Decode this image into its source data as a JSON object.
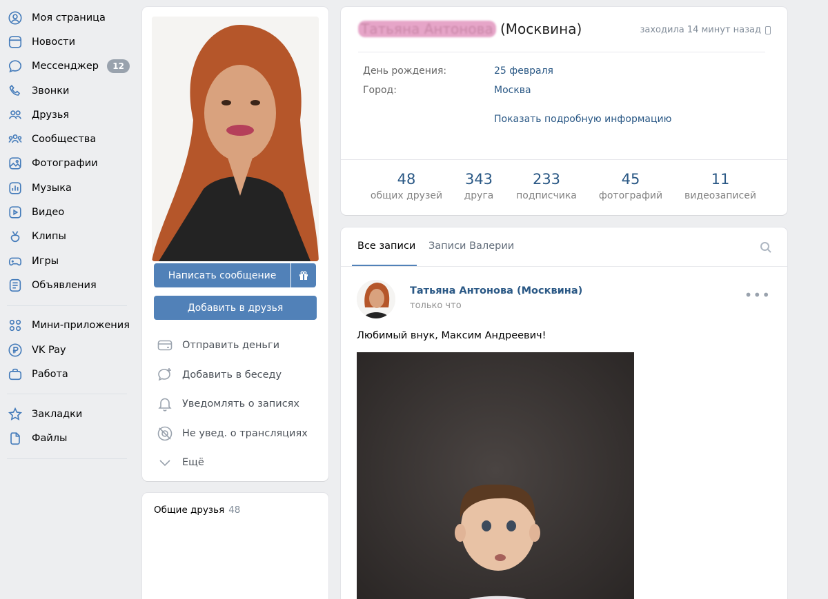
{
  "sidebar": {
    "items": [
      {
        "icon": "user-circle-icon",
        "label": "Моя страница"
      },
      {
        "icon": "news-icon",
        "label": "Новости"
      },
      {
        "icon": "chat-bubble-icon",
        "label": "Мессенджер",
        "badge": "12"
      },
      {
        "icon": "phone-icon",
        "label": "Звонки"
      },
      {
        "icon": "friends-icon",
        "label": "Друзья"
      },
      {
        "icon": "communities-icon",
        "label": "Сообщества"
      },
      {
        "icon": "photos-icon",
        "label": "Фотографии"
      },
      {
        "icon": "music-icon",
        "label": "Музыка"
      },
      {
        "icon": "video-icon",
        "label": "Видео"
      },
      {
        "icon": "clips-icon",
        "label": "Клипы"
      },
      {
        "icon": "gamepad-icon",
        "label": "Игры"
      },
      {
        "icon": "classifieds-icon",
        "label": "Объявления"
      }
    ],
    "items2": [
      {
        "icon": "mini-apps-icon",
        "label": "Мини-приложения"
      },
      {
        "icon": "vkpay-icon",
        "label": "VK Pay"
      },
      {
        "icon": "briefcase-icon",
        "label": "Работа"
      }
    ],
    "items3": [
      {
        "icon": "star-icon",
        "label": "Закладки"
      },
      {
        "icon": "file-icon",
        "label": "Файлы"
      }
    ]
  },
  "profile": {
    "send_message": "Написать сообщение",
    "add_friend": "Добавить в друзья",
    "actions": [
      {
        "icon": "send-money-icon",
        "label": "Отправить деньги"
      },
      {
        "icon": "add-chat-icon",
        "label": "Добавить в беседу"
      },
      {
        "icon": "bell-icon",
        "label": "Уведомлять о записях"
      },
      {
        "icon": "no-broadcast-icon",
        "label": "Не увед. о трансляциях"
      },
      {
        "icon": "chevron-down-icon",
        "label": "Ещё"
      }
    ],
    "common_friends_title": "Общие друзья",
    "common_friends_count": "48"
  },
  "info": {
    "name_blurred": "Татьяна Антонова",
    "name_suffix": " (Москвина)",
    "last_seen": "заходила 14 минут назад",
    "birthday_label": "День рождения:",
    "birthday_value": "25 февраля",
    "city_label": "Город:",
    "city_value": "Москва",
    "more_info": "Показать подробную информацию",
    "stats": [
      {
        "num": "48",
        "label": "общих друзей"
      },
      {
        "num": "343",
        "label": "друга"
      },
      {
        "num": "233",
        "label": "подписчика"
      },
      {
        "num": "45",
        "label": "фотографий"
      },
      {
        "num": "11",
        "label": "видеозаписей"
      }
    ]
  },
  "feed": {
    "tab_all": "Все записи",
    "tab_user": "Записи Валерии",
    "post": {
      "author": "Татьяна Антонова (Москвина)",
      "time": "только что",
      "menu": "•••",
      "text": "Любимый внук, Максим Андреевич!"
    }
  },
  "colors": {
    "accent": "#5181b8",
    "link": "#2a5885",
    "icon": "#447bba"
  }
}
